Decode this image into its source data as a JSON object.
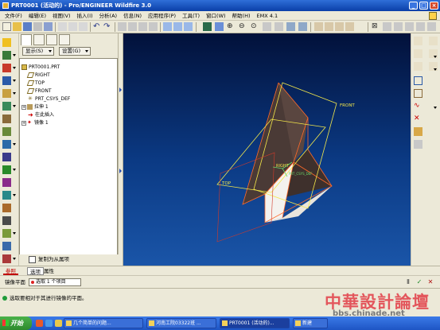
{
  "window": {
    "title": "PRT0001 (活动的) - Pro/ENGINEER Wildfire 3.0"
  },
  "menubar": {
    "items": [
      "文件(F)",
      "编辑(E)",
      "视图(V)",
      "插入(I)",
      "分析(A)",
      "信息(N)",
      "应用程序(P)",
      "工具(T)",
      "窗口(W)",
      "帮助(H)",
      "EMX 4.1"
    ]
  },
  "navigator": {
    "show_label": "显示(S)",
    "settings_label": "设置(G)",
    "tree": [
      {
        "label": "PRT0001.PRT",
        "icon": "part-icon"
      },
      {
        "label": "RIGHT",
        "icon": "datum-plane-icon"
      },
      {
        "label": "TOP",
        "icon": "datum-plane-icon"
      },
      {
        "label": "FRONT",
        "icon": "datum-plane-icon"
      },
      {
        "label": "PRT_CSYS_DEF",
        "icon": "csys-icon"
      },
      {
        "label": "拉伸 1",
        "icon": "extrude-icon"
      },
      {
        "label": "在此插入",
        "icon": "insert-arrow-icon"
      },
      {
        "label": "镜像 1",
        "icon": "mirror-icon"
      }
    ]
  },
  "viewport": {
    "labels": {
      "front": "FRONT",
      "top": "TOP",
      "right": "RIGHT",
      "csys": "PRT_CSYS_DEF"
    },
    "colors": {
      "plane": "#f4e84a",
      "edge": "#ff6a2a",
      "shade": "#4a3a36",
      "face": "#ffffff"
    }
  },
  "copy_option": {
    "label": "复制为从属项",
    "checked": false
  },
  "dashboard": {
    "tabs": [
      "参照",
      "选项",
      "属性"
    ],
    "mirror_plane_label": "镜像平面",
    "mirror_plane_value": "选取 1 个项目"
  },
  "message": {
    "text": "选取要相对于其进行镜像的平面。"
  },
  "watermark": {
    "chars": "中華設計論壇",
    "url": "bbs.chinade.net"
  },
  "taskbar": {
    "start_label": "开始",
    "tasks": [
      "几个简单的问题...",
      "河南工院03322班 ...",
      "PRT0001 (活动的)...",
      "新建"
    ]
  }
}
